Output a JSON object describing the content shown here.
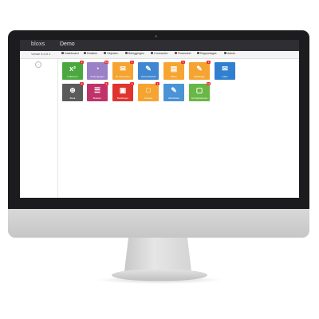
{
  "app": {
    "brand": "bloxs",
    "environment": "Demo",
    "version": "Versie 5.0.0.1"
  },
  "nav": [
    "Dashboard",
    "Relaties",
    "Objecten",
    "Beleggingen",
    "Contracten",
    "Financieel",
    "Rapportages",
    "Admin"
  ],
  "tiles": [
    {
      "label": "Indexeren",
      "icon": "x²",
      "badge": "3"
    },
    {
      "label": "Verlengingen",
      "icon": "◔",
      "badge": "12"
    },
    {
      "label": "Te verzenden",
      "icon": "✉",
      "badge": "1"
    },
    {
      "label": "Verhuurbeleid",
      "icon": "✎",
      "badge": ""
    },
    {
      "label": "Taken",
      "icon": "▤",
      "badge": "4"
    },
    {
      "label": "Meldingen",
      "icon": "✎",
      "badge": "3"
    },
    {
      "label": "Inbox",
      "icon": "✉",
      "badge": ""
    },
    {
      "label": "Boek",
      "icon": "⊕",
      "badge": "2"
    },
    {
      "label": "Boeken",
      "icon": "☰",
      "badge": "1"
    },
    {
      "label": "Betalingen",
      "icon": "▣",
      "badge": "1"
    },
    {
      "label": "Incasso",
      "icon": "□",
      "badge": "1"
    },
    {
      "label": "Afschriften",
      "icon": "✎",
      "badge": ""
    },
    {
      "label": "Termijnfacturen",
      "icon": "▢",
      "badge": "10"
    }
  ],
  "colors": {
    "topbar": "#2e2e33",
    "bezel": "#1c1c1e",
    "badge": "#e8322e"
  }
}
